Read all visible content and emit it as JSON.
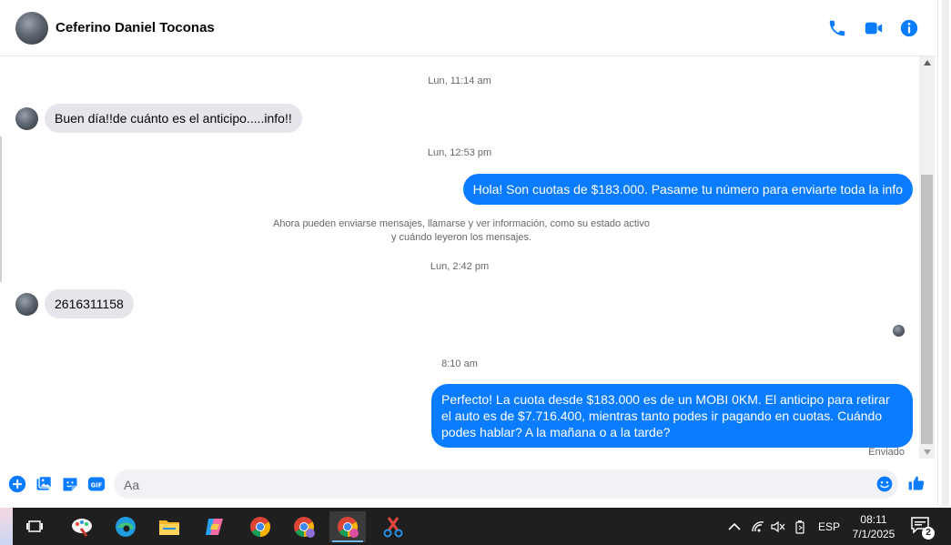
{
  "header": {
    "contact_name": "Ceferino Daniel Toconas",
    "icons": [
      "phone-icon",
      "video-icon",
      "info-icon"
    ],
    "accent_color": "#0a7cff"
  },
  "chat": {
    "timestamp_1": "Lun, 11:14 am",
    "msg_in_1": "Buen día!!de cuánto es el anticipo.....info!!",
    "timestamp_2": "Lun, 12:53 pm",
    "msg_out_1": "Hola! Son cuotas de $183.000. Pasame tu número para enviarte toda la info",
    "system_line_1": "Ahora pueden enviarse mensajes, llamarse y ver información, como su estado activo",
    "system_line_2": "y cuándo leyeron los mensajes.",
    "timestamp_3": "Lun, 2:42 pm",
    "msg_in_2": "2616311158",
    "timestamp_4": "8:10 am",
    "msg_out_2": "Perfecto! La cuota desde $183.000 es de un MOBI 0KM. El anticipo para retirar el auto es de $7.716.400, mientras tanto podes ir pagando en cuotas. Cuándo podes hablar? A la mañana o a la tarde?",
    "status": "Enviado",
    "bubble_in_color": "#e4e6eb",
    "bubble_out_color": "#0a7cff"
  },
  "composer": {
    "placeholder": "Aa",
    "icons": [
      "plus-icon",
      "image-icon",
      "sticker-icon",
      "gif-icon",
      "emoji-icon",
      "like-icon"
    ],
    "gif_label": "GIF"
  },
  "taskbar": {
    "apps": [
      "task-view-icon",
      "paint-icon",
      "edge-icon",
      "file-explorer-icon",
      "copilot-icon",
      "chrome-icon",
      "chrome-profile-icon",
      "chrome-profile-c-icon",
      "snipping-tool-icon"
    ],
    "language": "ESP",
    "time": "08:11",
    "date": "7/1/2025",
    "notifications": "2"
  }
}
